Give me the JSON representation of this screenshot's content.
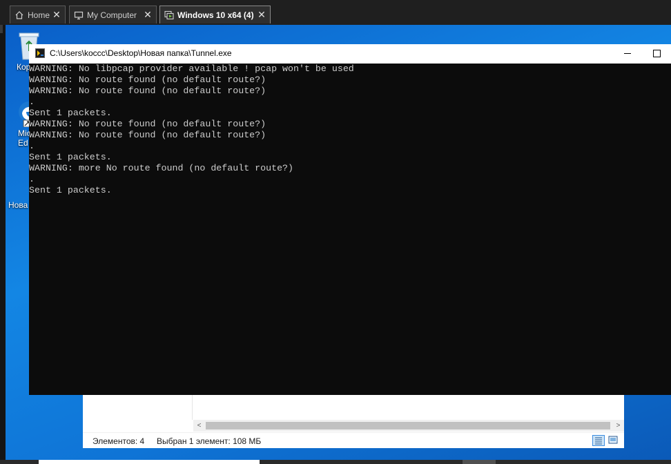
{
  "tabs": [
    {
      "label": "Home",
      "icon": "home-icon",
      "active": false
    },
    {
      "label": "My Computer",
      "icon": "monitor-icon",
      "active": false
    },
    {
      "label": "Windows 10 x64 (4)",
      "icon": "vm-icon",
      "active": true
    }
  ],
  "tab_close_glyph": "✕",
  "desktop_icons": [
    {
      "label": "Кор",
      "icon": "recycle-bin-icon"
    },
    {
      "label": "Micr\nEd",
      "icon": "edge-icon"
    },
    {
      "label": "Нова",
      "icon": "folder-icon"
    }
  ],
  "console": {
    "title": "C:\\Users\\koccc\\Desktop\\Новая папка\\Tunnel.exe",
    "lines": [
      "WARNING: No libpcap provider available ! pcap won't be used",
      "WARNING: No route found (no default route?)",
      "WARNING: No route found (no default route?)",
      ".",
      "Sent 1 packets.",
      "WARNING: No route found (no default route?)",
      "WARNING: No route found (no default route?)",
      ".",
      "Sent 1 packets.",
      "WARNING: more No route found (no default route?)",
      ".",
      "Sent 1 packets."
    ]
  },
  "explorer": {
    "status_items": "Элементов: 4",
    "status_selected": "Выбран 1 элемент: 108 МБ",
    "scroll_left": "<",
    "scroll_right": ">"
  },
  "colors": {
    "console_bg": "#0c0c0c",
    "console_text": "#cccccc",
    "desktop_blue": "#1386e4"
  }
}
